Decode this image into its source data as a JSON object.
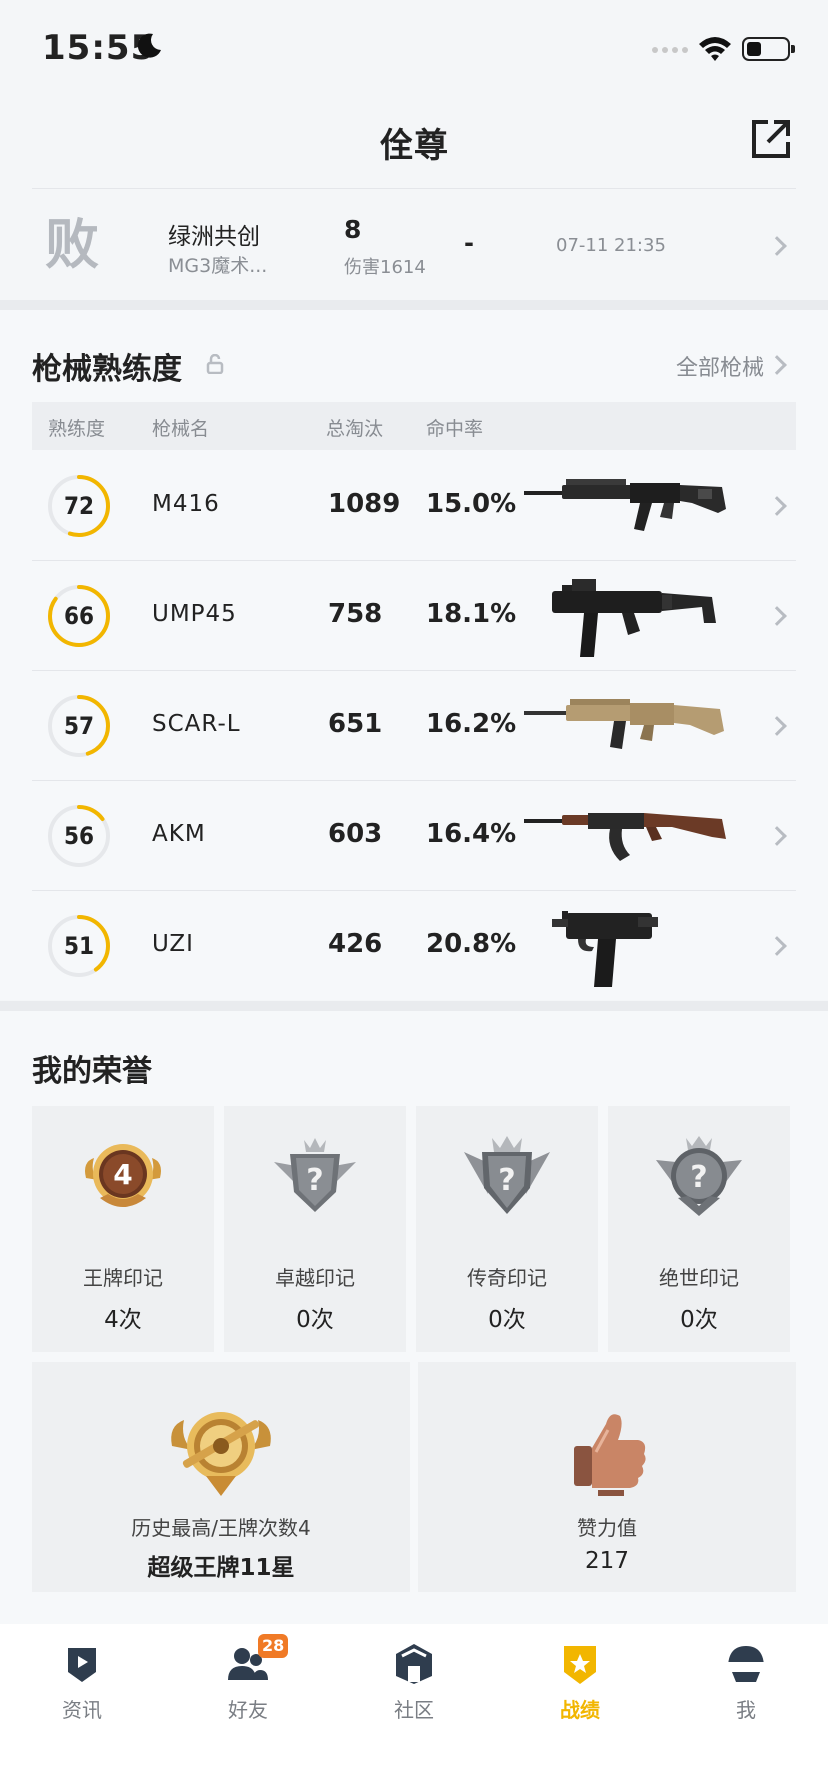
{
  "status_bar": {
    "time": "15:55"
  },
  "header": {
    "title": "佺尊"
  },
  "recent_match": {
    "result": "败",
    "map": "绿洲共创",
    "mode": "MG3魔术...",
    "kills": "8",
    "damage": "伤害1614",
    "placement": "-",
    "date": "07-11 21:35"
  },
  "proficiency": {
    "title": "枪械熟练度",
    "all_link": "全部枪械",
    "headers": {
      "level": "熟练度",
      "name": "枪械名",
      "eliminations": "总淘汰",
      "hit_rate": "命中率"
    },
    "weapons": [
      {
        "level": "72",
        "name": "M416",
        "eliminations": "1089",
        "hit_rate": "15.0%",
        "progress": 0.55
      },
      {
        "level": "66",
        "name": "UMP45",
        "eliminations": "758",
        "hit_rate": "18.1%",
        "progress": 0.85
      },
      {
        "level": "57",
        "name": "SCAR-L",
        "eliminations": "651",
        "hit_rate": "16.2%",
        "progress": 0.45
      },
      {
        "level": "56",
        "name": "AKM",
        "eliminations": "603",
        "hit_rate": "16.4%",
        "progress": 0.15
      },
      {
        "level": "51",
        "name": "UZI",
        "eliminations": "426",
        "hit_rate": "20.8%",
        "progress": 0.4
      }
    ]
  },
  "honors": {
    "title": "我的荣誉",
    "marks": [
      {
        "label": "王牌印记",
        "count": "4次",
        "emblem_text": "4"
      },
      {
        "label": "卓越印记",
        "count": "0次",
        "emblem_text": "?"
      },
      {
        "label": "传奇印记",
        "count": "0次",
        "emblem_text": "?"
      },
      {
        "label": "绝世印记",
        "count": "0次",
        "emblem_text": "?"
      }
    ],
    "highest": {
      "label": "历史最高/王牌次数4",
      "value": "超级王牌11星"
    },
    "likes": {
      "label": "赞力值",
      "value": "217"
    }
  },
  "tab_bar": {
    "tabs": [
      {
        "label": "资讯",
        "icon": "news-icon"
      },
      {
        "label": "好友",
        "icon": "friends-icon",
        "badge": "28"
      },
      {
        "label": "社区",
        "icon": "community-icon"
      },
      {
        "label": "战绩",
        "icon": "stats-icon",
        "active": true
      },
      {
        "label": "我",
        "icon": "profile-icon"
      }
    ]
  },
  "colors": {
    "accent": "#f2b600",
    "badge": "#f07a26",
    "progress_track": "#e6e8eb"
  }
}
